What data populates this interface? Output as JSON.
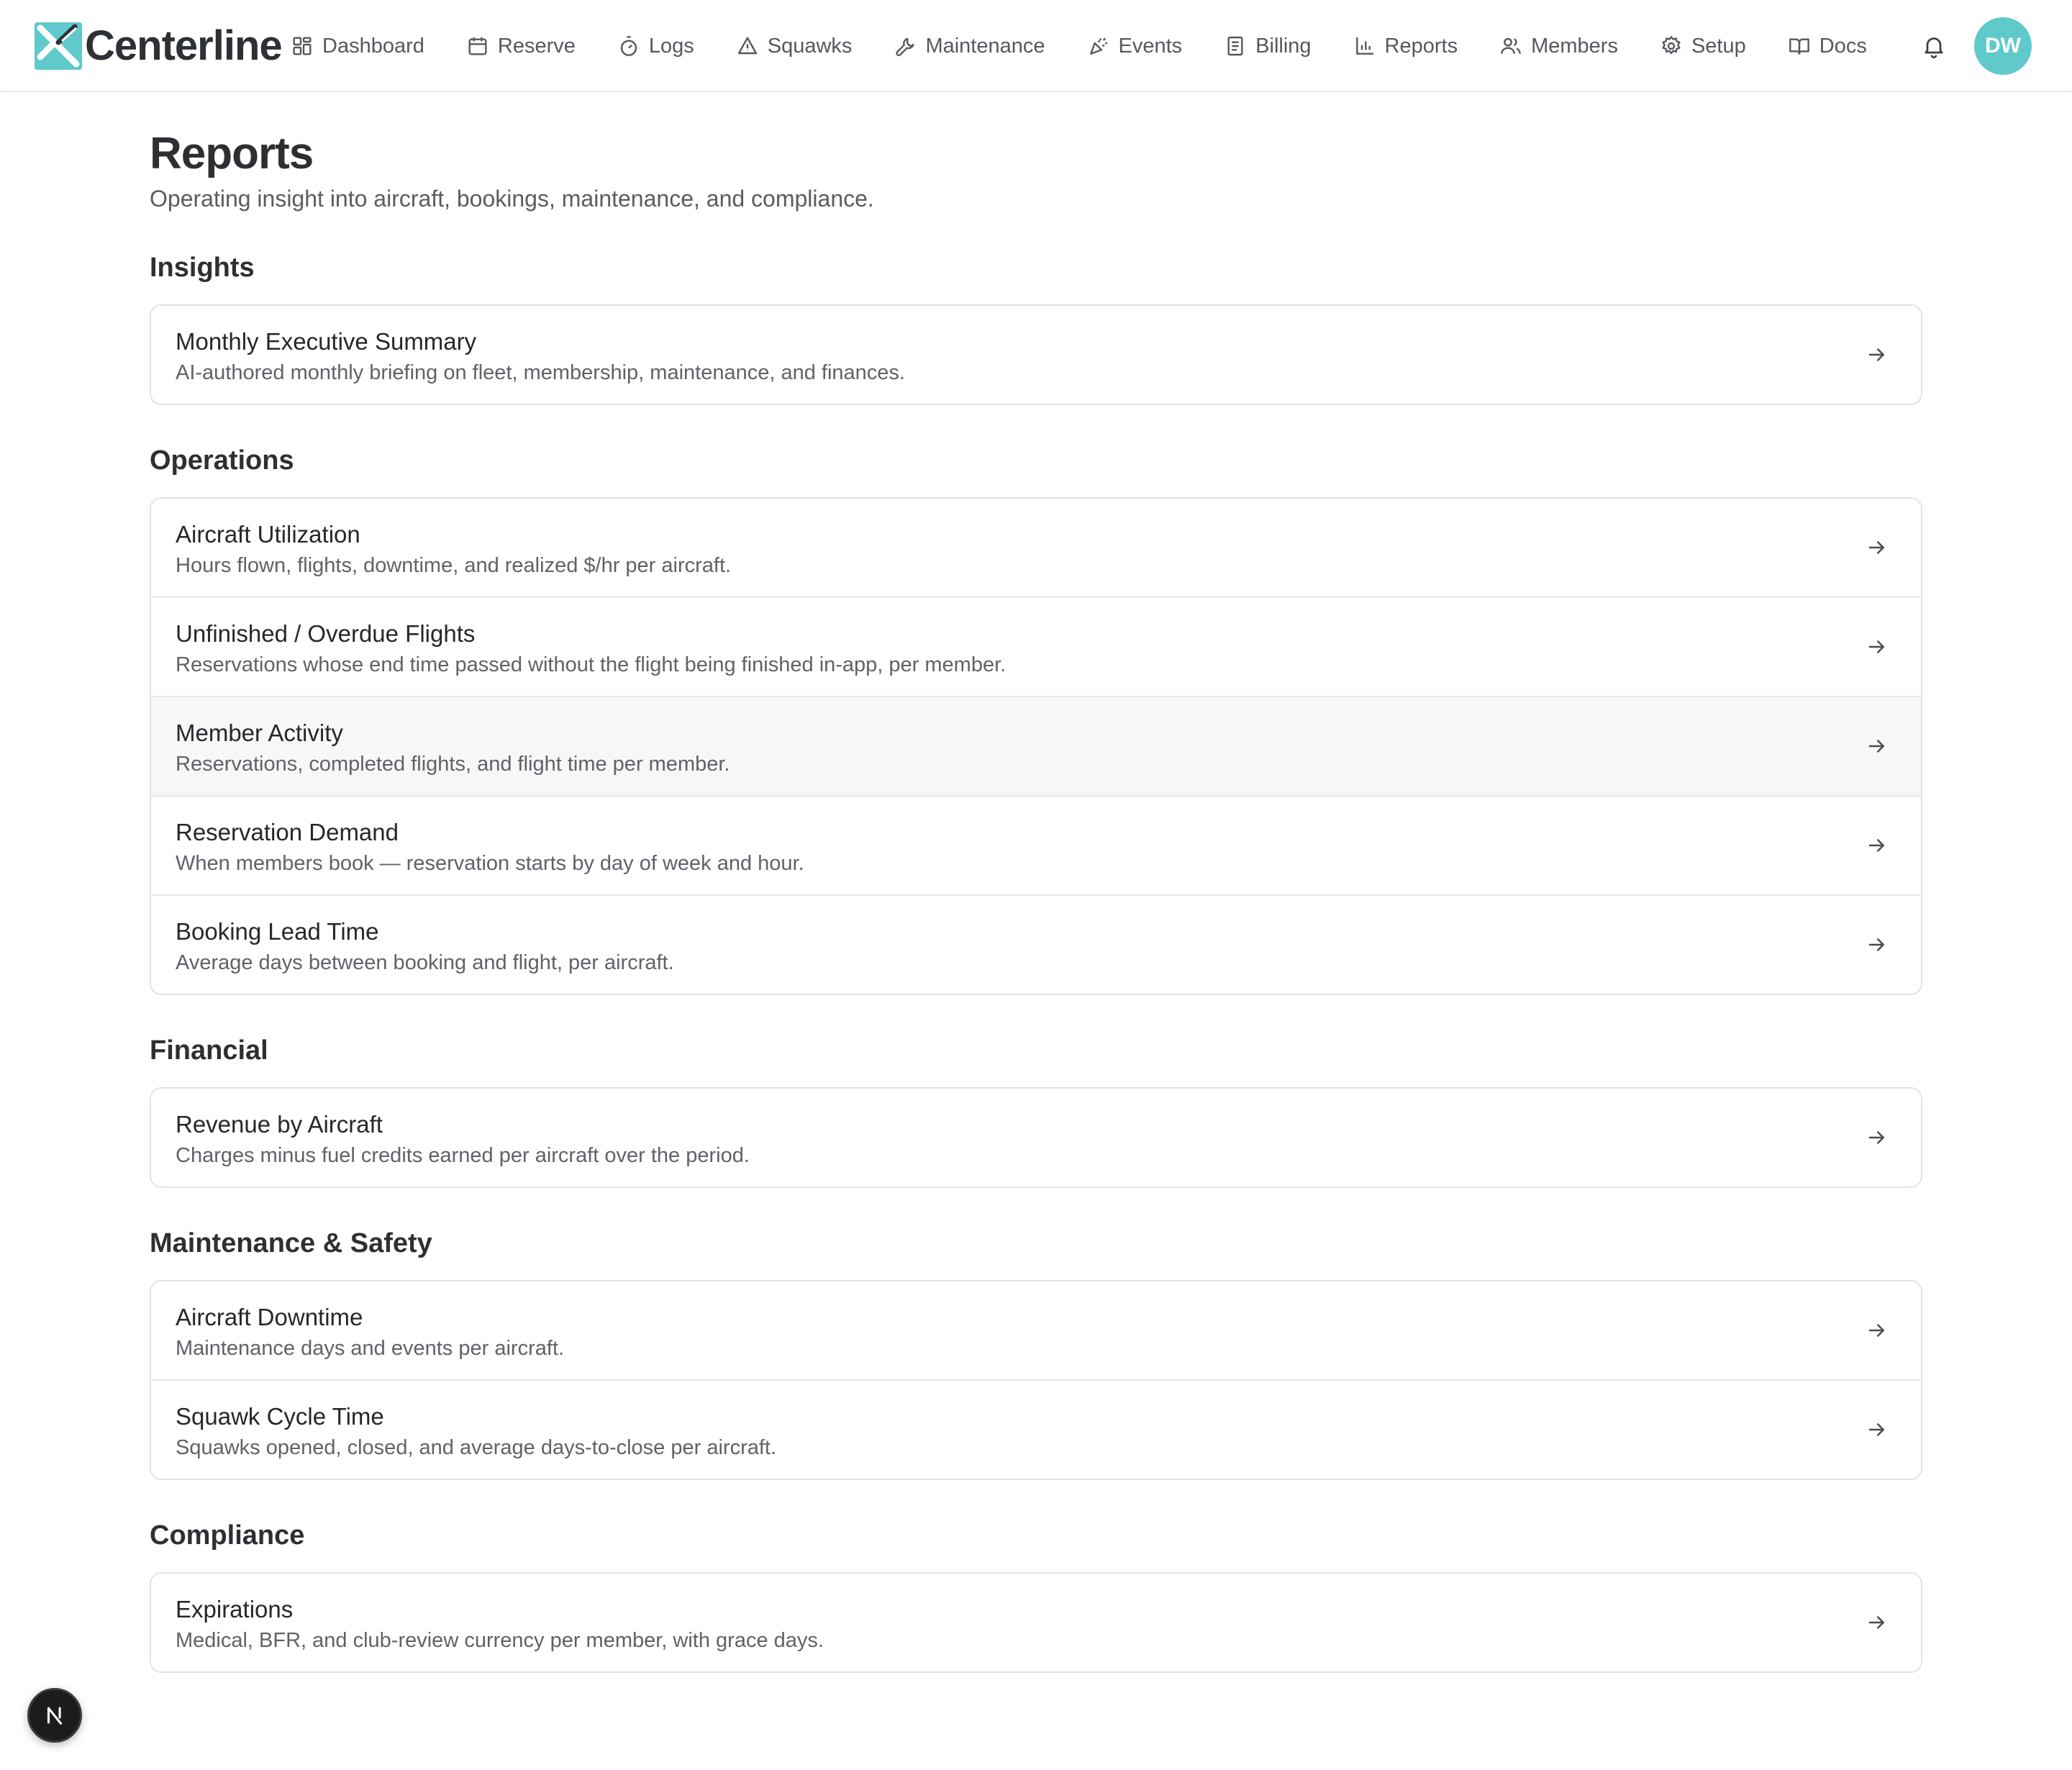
{
  "app": {
    "brand": "Centerline",
    "brand_color": "#5fc9cb"
  },
  "nav": {
    "items": [
      {
        "label": "Dashboard",
        "icon": "dashboard-grid-icon"
      },
      {
        "label": "Reserve",
        "icon": "calendar-icon"
      },
      {
        "label": "Logs",
        "icon": "stopwatch-icon"
      },
      {
        "label": "Squawks",
        "icon": "warning-triangle-icon"
      },
      {
        "label": "Maintenance",
        "icon": "wrench-icon"
      },
      {
        "label": "Events",
        "icon": "party-popper-icon"
      },
      {
        "label": "Billing",
        "icon": "receipt-icon"
      },
      {
        "label": "Reports",
        "icon": "bar-chart-icon"
      },
      {
        "label": "Members",
        "icon": "users-icon"
      },
      {
        "label": "Setup",
        "icon": "gear-icon"
      },
      {
        "label": "Docs",
        "icon": "book-open-icon"
      }
    ],
    "notifications_icon": "bell-icon",
    "avatar_initials": "DW"
  },
  "page": {
    "title": "Reports",
    "subtitle": "Operating insight into aircraft, bookings, maintenance, and compliance."
  },
  "sections": [
    {
      "title": "Insights",
      "reports": [
        {
          "title": "Monthly Executive Summary",
          "description": "AI-authored monthly briefing on fleet, membership, maintenance, and finances."
        }
      ]
    },
    {
      "title": "Operations",
      "reports": [
        {
          "title": "Aircraft Utilization",
          "description": "Hours flown, flights, downtime, and realized $/hr per aircraft."
        },
        {
          "title": "Unfinished / Overdue Flights",
          "description": "Reservations whose end time passed without the flight being finished in-app, per member."
        },
        {
          "title": "Member Activity",
          "description": "Reservations, completed flights, and flight time per member."
        },
        {
          "title": "Reservation Demand",
          "description": "When members book — reservation starts by day of week and hour."
        },
        {
          "title": "Booking Lead Time",
          "description": "Average days between booking and flight, per aircraft."
        }
      ]
    },
    {
      "title": "Financial",
      "reports": [
        {
          "title": "Revenue by Aircraft",
          "description": "Charges minus fuel credits earned per aircraft over the period."
        }
      ]
    },
    {
      "title": "Maintenance & Safety",
      "reports": [
        {
          "title": "Aircraft Downtime",
          "description": "Maintenance days and events per aircraft."
        },
        {
          "title": "Squawk Cycle Time",
          "description": "Squawks opened, closed, and average days-to-close per aircraft."
        }
      ]
    },
    {
      "title": "Compliance",
      "reports": [
        {
          "title": "Expirations",
          "description": "Medical, BFR, and club-review currency per member, with grace days."
        }
      ]
    }
  ],
  "fab": {
    "label": "N",
    "icon": "next-logo-icon"
  }
}
